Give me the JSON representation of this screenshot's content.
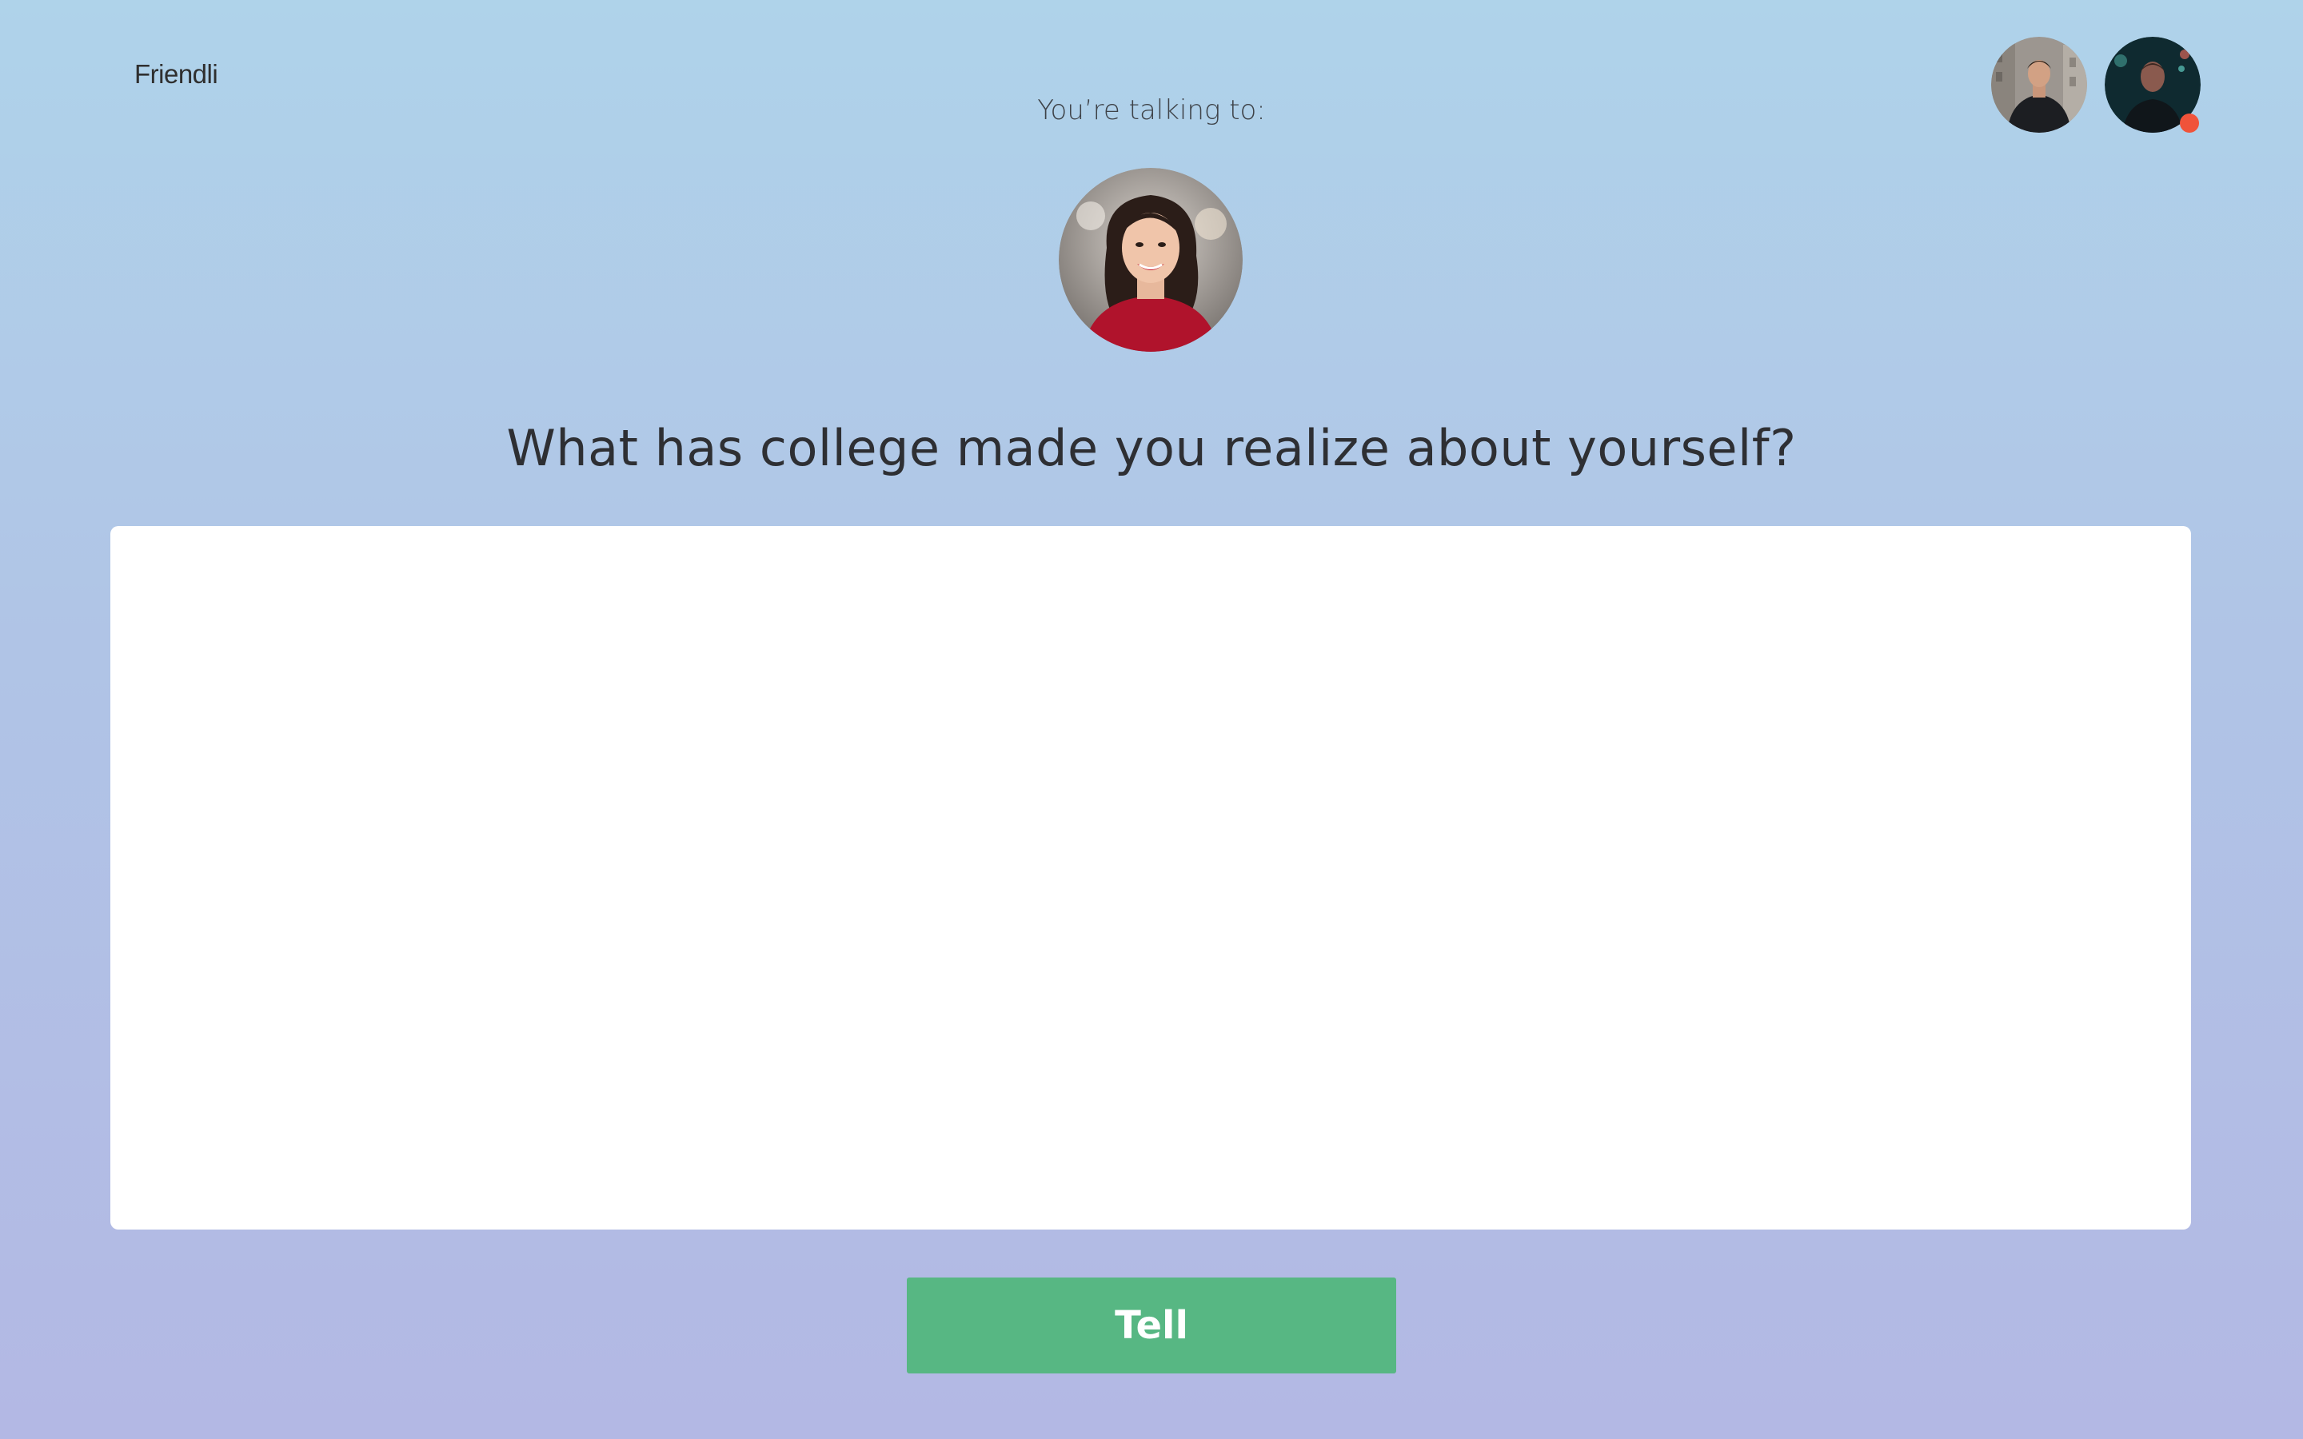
{
  "app": {
    "brand": "Friendli"
  },
  "header": {
    "talking_label": "You’re talking to:"
  },
  "question": {
    "text": "What has college made you realize about yourself?"
  },
  "answer": {
    "value": "",
    "placeholder": ""
  },
  "actions": {
    "tell_label": "Tell"
  },
  "colors": {
    "accent_green": "#57b783",
    "status_dot": "#f0533a",
    "gradient_top": "#afd3ea",
    "gradient_bottom": "#b3b8e4"
  }
}
